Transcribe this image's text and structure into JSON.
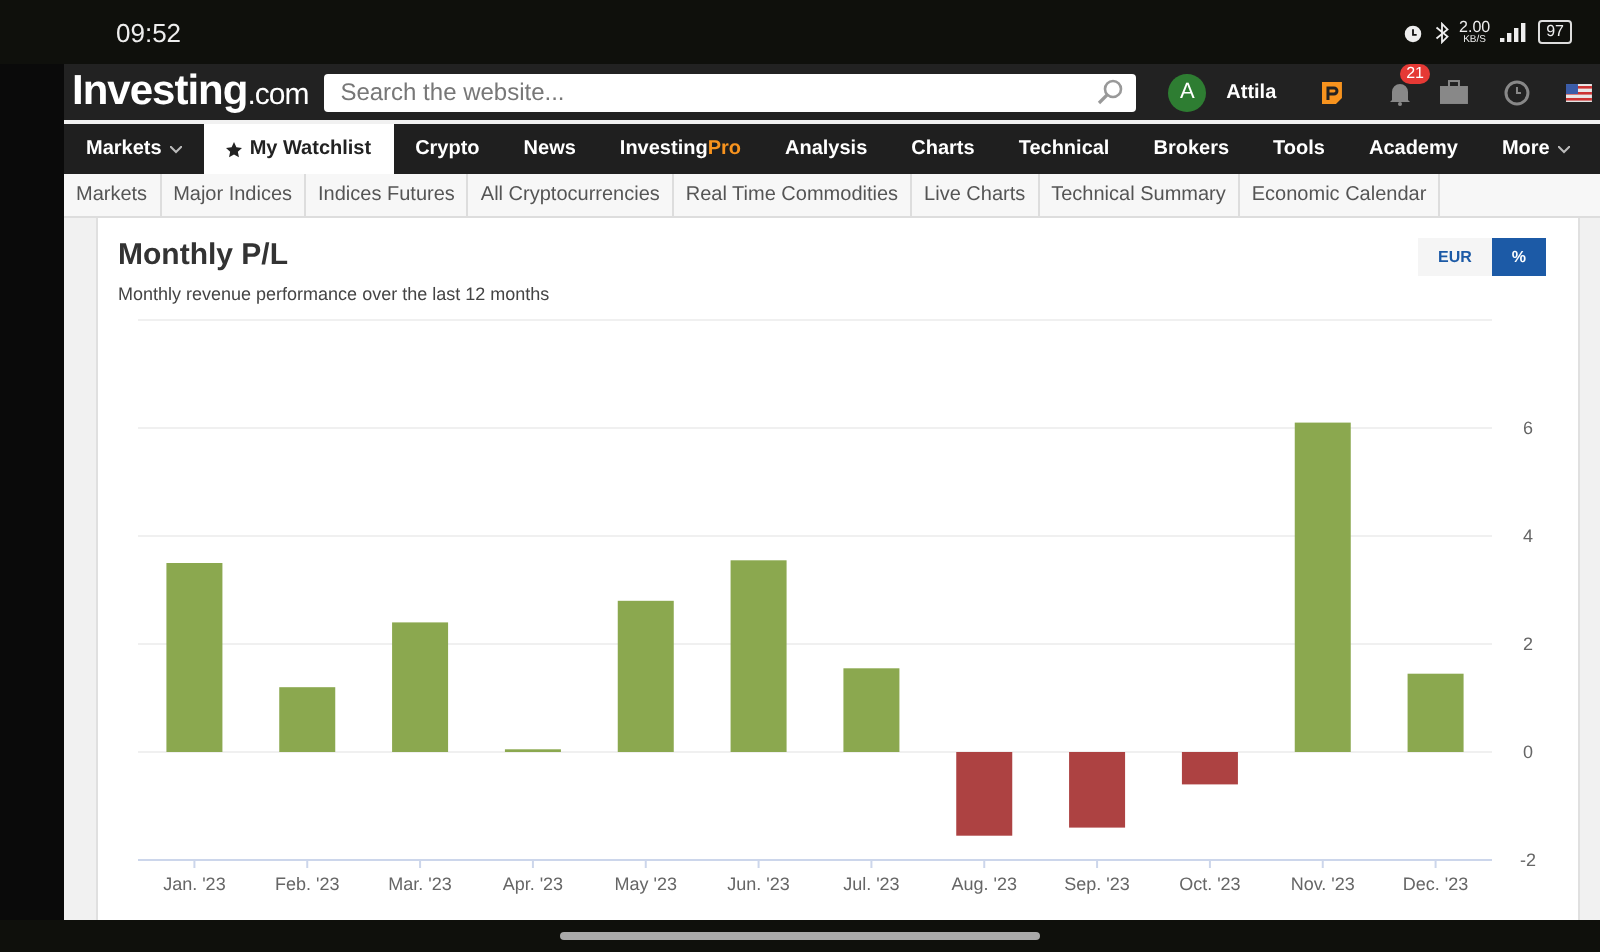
{
  "status_bar": {
    "time": "09:52",
    "speed": "2.00",
    "speed_unit": "KB/S",
    "battery": "97"
  },
  "header": {
    "logo": "Investing",
    "logo_suffix": ".com",
    "search": {
      "placeholder": "Search the website..."
    },
    "user": {
      "initial": "A",
      "name": "Attila"
    },
    "notifications": "21"
  },
  "nav": [
    {
      "label": "Markets",
      "kind": "dropdown",
      "selected": false
    },
    {
      "label": "My Watchlist",
      "kind": "star",
      "selected": true
    },
    {
      "label": "Crypto",
      "kind": "plain",
      "selected": false
    },
    {
      "label": "News",
      "kind": "plain",
      "selected": false
    },
    {
      "label": "Investing",
      "accent": "Pro",
      "kind": "brand",
      "selected": false
    },
    {
      "label": "Analysis",
      "kind": "plain",
      "selected": false
    },
    {
      "label": "Charts",
      "kind": "plain",
      "selected": false
    },
    {
      "label": "Technical",
      "kind": "plain",
      "selected": false
    },
    {
      "label": "Brokers",
      "kind": "plain",
      "selected": false
    },
    {
      "label": "Tools",
      "kind": "plain",
      "selected": false
    },
    {
      "label": "Academy",
      "kind": "plain",
      "selected": false
    },
    {
      "label": "More",
      "kind": "dropdown",
      "selected": false
    }
  ],
  "subnav": [
    "Markets",
    "Major Indices",
    "Indices Futures",
    "All Cryptocurrencies",
    "Real Time Commodities",
    "Live Charts",
    "Technical Summary",
    "Economic Calendar"
  ],
  "card": {
    "title": "Monthly P/L",
    "subtitle": "Monthly revenue performance over the last 12 months",
    "toggle": [
      {
        "label": "EUR",
        "selected": false
      },
      {
        "label": "%",
        "selected": true
      }
    ],
    "chart_data": {
      "type": "bar",
      "categories": [
        "Jan. '23",
        "Feb. '23",
        "Mar. '23",
        "Apr. '23",
        "May '23",
        "Jun. '23",
        "Jul. '23",
        "Aug. '23",
        "Sep. '23",
        "Oct. '23",
        "Nov. '23",
        "Dec. '23"
      ],
      "series": [
        {
          "color": "#8ba84f",
          "values": [
            3.5,
            1.2,
            2.4,
            0.05,
            2.8,
            3.55,
            1.55,
            null,
            null,
            null,
            6.1,
            1.45
          ]
        },
        {
          "color": "#ad4242",
          "values": [
            null,
            null,
            null,
            null,
            null,
            null,
            null,
            -1.55,
            -1.4,
            -0.6,
            null,
            null
          ]
        }
      ],
      "stacked": true,
      "grid": true,
      "ylim": [
        -2,
        8
      ],
      "yticks": [
        -2,
        0,
        2,
        4,
        6
      ]
    }
  }
}
